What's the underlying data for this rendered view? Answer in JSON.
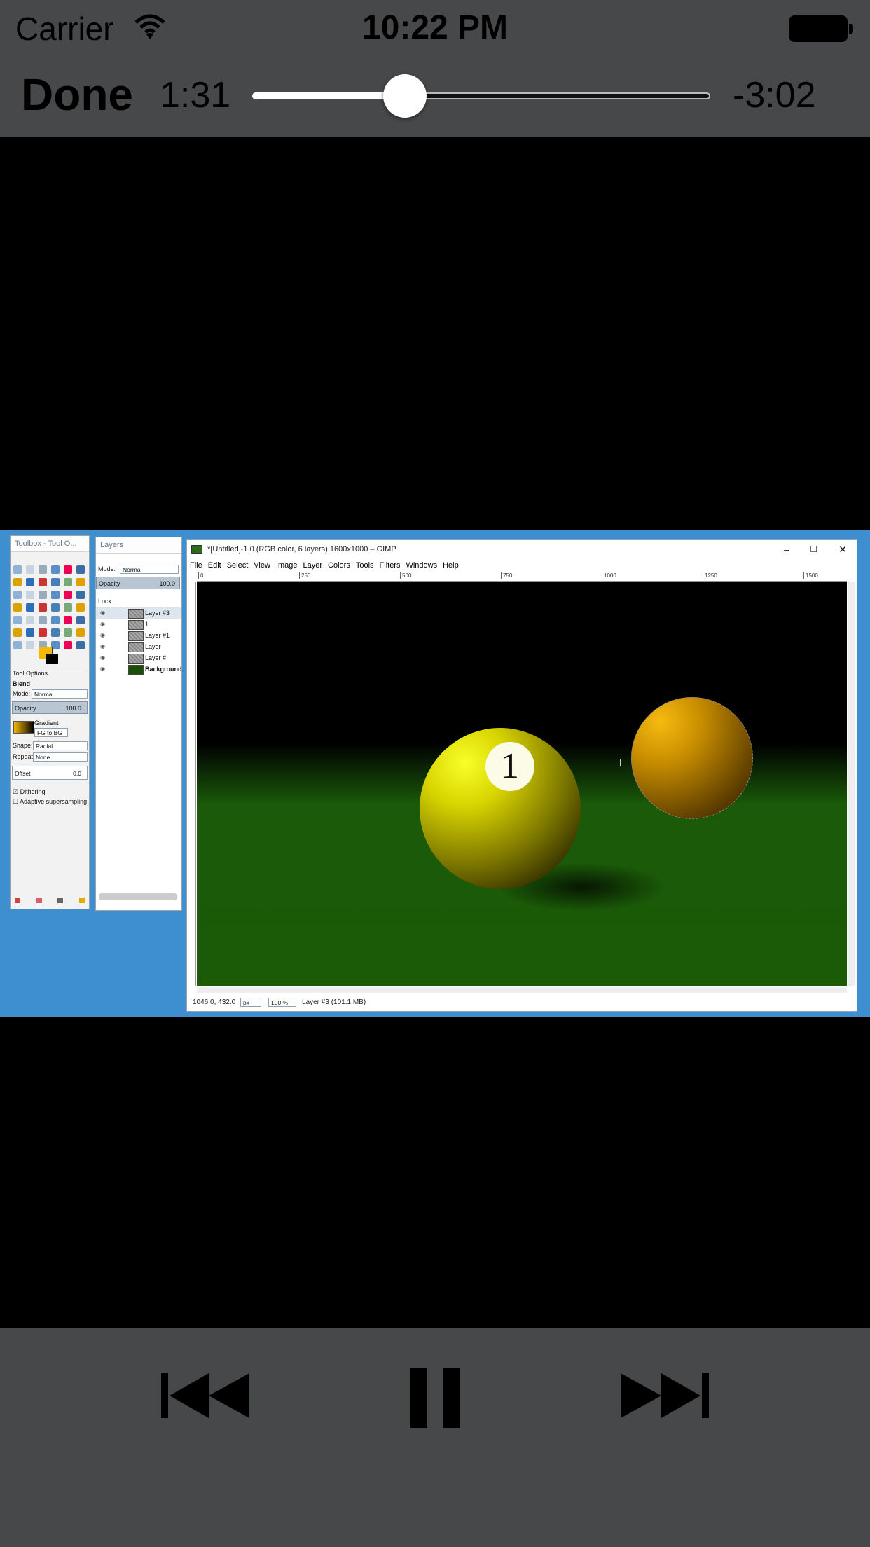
{
  "status_bar": {
    "carrier": "Carrier",
    "time": "10:22 PM",
    "wifi_icon": "wifi-icon",
    "battery_icon": "battery-icon",
    "battery_level": 1.0
  },
  "player": {
    "done_label": "Done",
    "elapsed": "1:31",
    "remaining": "-3:02",
    "progress": 0.334
  },
  "controls": {
    "previous_icon": "previous-track-icon",
    "pause_icon": "pause-icon",
    "next_icon": "next-track-icon"
  },
  "video": {
    "toolbox": {
      "title": "Toolbox - Tool O...",
      "tool_options_tab": "Tool Options",
      "blend_label": "Blend",
      "mode_label": "Mode:",
      "mode_value": "Normal",
      "opacity_label": "Opacity",
      "opacity_value": "100.0",
      "gradient_label": "Gradient",
      "gradient_value": "FG to BG (",
      "shape_label": "Shape:",
      "shape_value": "Radial",
      "repeat_label": "Repeat:",
      "repeat_value": "None",
      "offset_label": "Offset",
      "offset_value": "0.0",
      "dithering_label": "Dithering",
      "adaptive_label": "Adaptive supersampling"
    },
    "layers_panel": {
      "title": "Layers",
      "mode_label": "Mode:",
      "mode_value": "Normal",
      "opacity_label": "Opacity",
      "opacity_value": "100.0",
      "lock_label": "Lock:",
      "layers": [
        "Layer #3",
        "1",
        "Layer #1",
        "Layer",
        "Layer #",
        "Background"
      ]
    },
    "gimp_window": {
      "title": "*[Untitled]-1.0 (RGB color, 6 layers) 1600x1000 – GIMP",
      "menus": [
        "File",
        "Edit",
        "Select",
        "View",
        "Image",
        "Layer",
        "Colors",
        "Tools",
        "Filters",
        "Windows",
        "Help"
      ],
      "ruler_labels": [
        "0",
        "250",
        "500",
        "750",
        "1000",
        "1250",
        "1500"
      ],
      "ball_number": "1",
      "coords": "1046.0, 432.0",
      "unit": "px",
      "zoom": "100 %",
      "layer_status": "Layer #3 (101.1 MB)"
    }
  }
}
